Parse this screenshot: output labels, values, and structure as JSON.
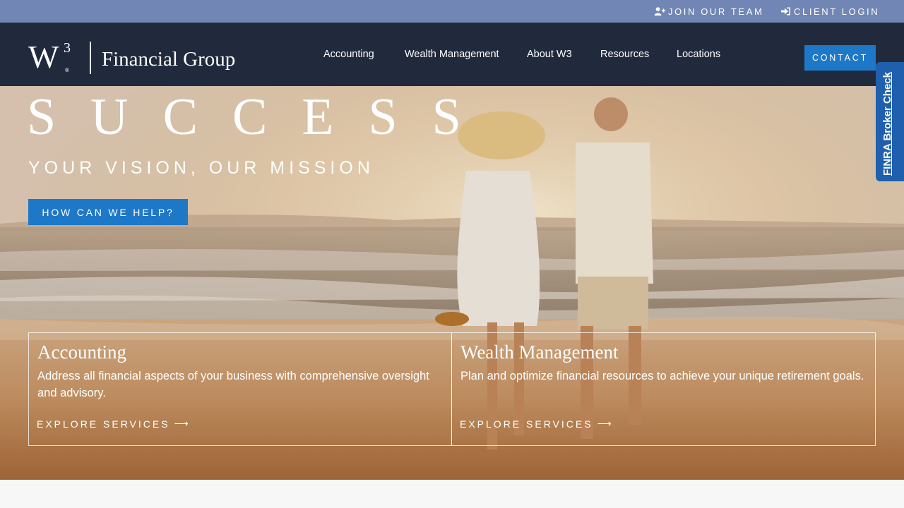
{
  "topbar": {
    "join_label": "JOIN OUR TEAM",
    "join_icon": "user-plus-icon",
    "login_label": "CLIENT LOGIN",
    "login_icon": "sign-in-icon"
  },
  "header": {
    "logo_mark": "W",
    "logo_superscript": "3",
    "logo_registered": "®",
    "logo_text": "Financial Group",
    "nav": [
      {
        "label": "Accounting"
      },
      {
        "label": "Wealth Management"
      },
      {
        "label": "About W3"
      },
      {
        "label": "Resources"
      },
      {
        "label": "Locations"
      }
    ],
    "contact_label": "CONTACT"
  },
  "hero": {
    "title": "SUCCESS",
    "subtitle": "YOUR VISION, OUR MISSION",
    "cta_label": "HOW CAN WE HELP?",
    "cards": [
      {
        "title": "Accounting",
        "description": "Address all financial aspects of your business with comprehensive oversight and advisory.",
        "link_label": "EXPLORE SERVICES",
        "link_icon": "arrow-right-icon"
      },
      {
        "title": "Wealth Management",
        "description": "Plan and optimize financial resources to achieve your unique retirement goals.",
        "link_label": "EXPLORE SERVICES",
        "link_icon": "arrow-right-icon"
      }
    ]
  },
  "finra": {
    "label": "FINRA Broker Check"
  },
  "colors": {
    "topbar": "#7186b5",
    "header": "#212a3d",
    "accent": "#1e78c8",
    "finra": "#1f5fae"
  }
}
